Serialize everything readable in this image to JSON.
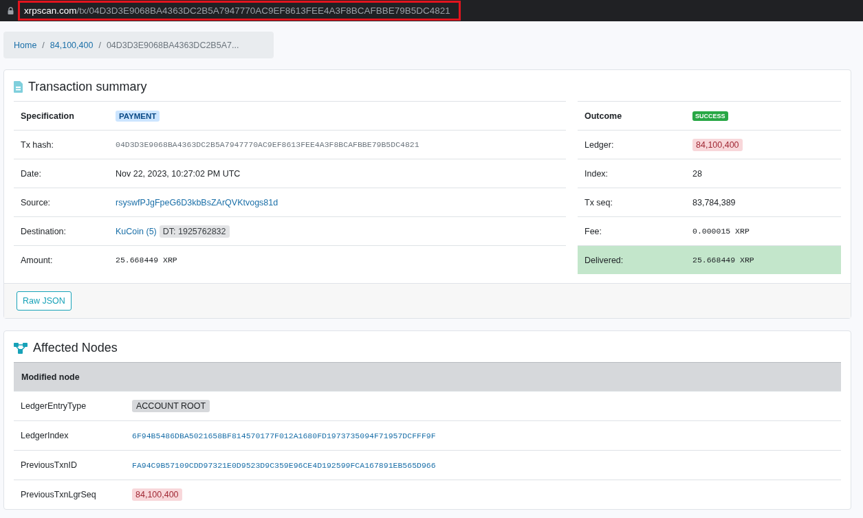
{
  "address_bar": {
    "domain": "xrpscan.com",
    "path": "/tx/04D3D3E9068BA4363DC2B5A7947770AC9EF8613FEE4A3F8BCAFBBE79B5DC4821",
    "highlighted": true
  },
  "breadcrumb_separator": "/",
  "breadcrumb": [
    {
      "label": "Home",
      "kind": "link"
    },
    {
      "label": "84,100,400",
      "kind": "link"
    },
    {
      "label": "04D3D3E9068BA4363DC2B5A7...",
      "kind": "current"
    }
  ],
  "summary": {
    "title": "Transaction summary",
    "spec": {
      "label": "Specification",
      "badge": "PAYMENT"
    },
    "rows": [
      {
        "label": "Tx hash:",
        "value": "04D3D3E9068BA4363DC2B5A7947770AC9EF8613FEE4A3F8BCAFBBE79B5DC4821",
        "kind": "hash"
      },
      {
        "label": "Date:",
        "value": "Nov 22, 2023, 10:27:02 PM UTC",
        "kind": "text"
      },
      {
        "label": "Source:",
        "value": "rsyswfPJgFpeG6D3kbBsZArQVKtvogs81d",
        "kind": "link"
      },
      {
        "label": "Destination:",
        "value": "KuCoin (5)",
        "tag": "DT: 1925762832",
        "kind": "link"
      },
      {
        "label": "Amount:",
        "value": "25.668449 XRP",
        "kind": "mono"
      }
    ],
    "outcome": {
      "label": "Outcome",
      "badge": "SUCCESS"
    },
    "outcome_rows": [
      {
        "label": "Ledger:",
        "value": "84,100,400",
        "kind": "ledger",
        "highlighted": false
      },
      {
        "label": "Index:",
        "value": "28",
        "kind": "text",
        "highlighted": false
      },
      {
        "label": "Tx seq:",
        "value": "83,784,389",
        "kind": "text",
        "highlighted": false
      },
      {
        "label": "Fee:",
        "value": "0.000015 XRP",
        "kind": "mono",
        "highlighted": false
      },
      {
        "label": "Delivered:",
        "value": "25.668449 XRP",
        "kind": "mono",
        "highlighted": true
      }
    ],
    "raw_button": "Raw JSON"
  },
  "affected": {
    "title": "Affected Nodes",
    "header": "Modified node",
    "rows": [
      {
        "label": "LedgerEntryType",
        "value": "ACCOUNT ROOT",
        "kind": "grey-badge"
      },
      {
        "label": "LedgerIndex",
        "value": "6F94B5486DBA5021658BF814570177F012A1680FD1973735094F71957DCFFF9F",
        "kind": "hash-link"
      },
      {
        "label": "PreviousTxnID",
        "value": "FA94C9B57109CDD97321E0D9523D9C359E96CE4D192599FCA167891EB565D966",
        "kind": "hash-link"
      },
      {
        "label": "PreviousTxnLgrSeq",
        "value": "84,100,400",
        "kind": "ledger"
      }
    ]
  }
}
